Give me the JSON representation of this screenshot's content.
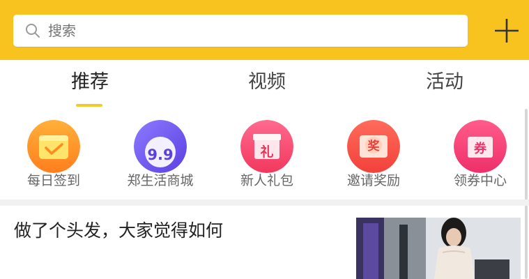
{
  "search": {
    "placeholder": "搜索"
  },
  "tabs": [
    {
      "label": "推荐"
    },
    {
      "label": "视频"
    },
    {
      "label": "活动"
    }
  ],
  "quick_entries": [
    {
      "label": "每日签到",
      "icon": "checkin-envelope-icon"
    },
    {
      "label": "郑生活商城",
      "icon": "mall-9.9-icon",
      "badge": "9.9"
    },
    {
      "label": "新人礼包",
      "icon": "gift-icon",
      "badge": "礼"
    },
    {
      "label": "邀请奖励",
      "icon": "invite-reward-icon",
      "badge": "奖"
    },
    {
      "label": "领券中心",
      "icon": "coupon-icon",
      "badge": "券"
    }
  ],
  "feed": [
    {
      "title": "做了个头发，大家觉得如何"
    }
  ],
  "colors": {
    "brand": "#F8C21F",
    "tab_underline": "#F4CB2C"
  }
}
